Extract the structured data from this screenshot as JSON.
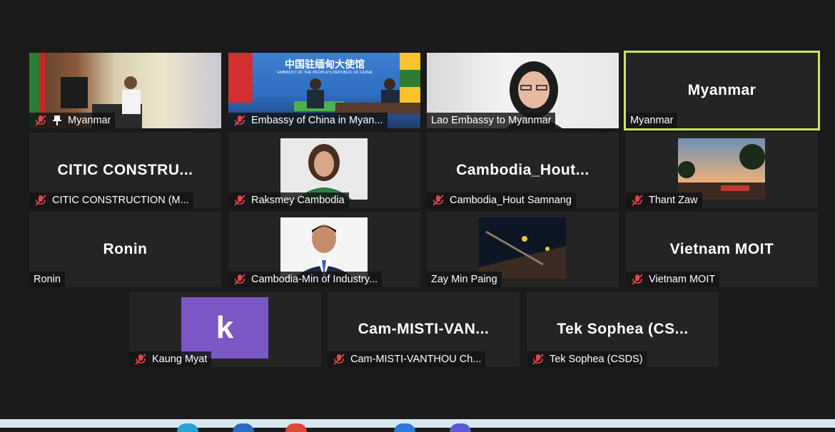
{
  "gallery": {
    "tiles": [
      {
        "label": "Myanmar",
        "muted": true,
        "pinned": true,
        "kind": "video-speaker"
      },
      {
        "label": "Embassy of China in Myan...",
        "muted": true,
        "kind": "video-embassy",
        "banner_cn": "中国驻缅甸大使馆",
        "banner_en": "EMBASSY OF THE PEOPLE'S REPUBLIC OF CHINA"
      },
      {
        "label": "Lao Embassy to Myanmar",
        "muted": false,
        "kind": "video-lao"
      },
      {
        "label": "Myanmar",
        "muted": false,
        "kind": "name",
        "display_name": "Myanmar",
        "active_speaker": true
      },
      {
        "label": "CITIC CONSTRUCTION (M...",
        "muted": true,
        "kind": "name",
        "display_name": "CITIC  CONSTRU..."
      },
      {
        "label": "Raksmey Cambodia",
        "muted": true,
        "kind": "photo"
      },
      {
        "label": "Cambodia_Hout Samnang",
        "muted": true,
        "kind": "name",
        "display_name": "Cambodia_Hout..."
      },
      {
        "label": "Thant Zaw",
        "muted": true,
        "kind": "photo"
      },
      {
        "label": "Ronin",
        "muted": false,
        "kind": "name",
        "display_name": "Ronin"
      },
      {
        "label": "Cambodia-Min of Industry...",
        "muted": true,
        "kind": "photo"
      },
      {
        "label": "Zay Min Paing",
        "muted": false,
        "kind": "photo"
      },
      {
        "label": "Vietnam MOIT",
        "muted": true,
        "kind": "name",
        "display_name": "Vietnam MOIT"
      },
      {
        "label": "Kaung Myat",
        "muted": true,
        "kind": "avatar",
        "avatar_letter": "k"
      },
      {
        "label": "Cam-MISTI-VANTHOU Ch...",
        "muted": true,
        "kind": "name",
        "display_name": "Cam-MISTI-VAN..."
      },
      {
        "label": "Tek Sophea (CSDS)",
        "muted": true,
        "kind": "name",
        "display_name": "Tek Sophea (CS..."
      }
    ]
  },
  "colors": {
    "background": "#1a1a1a",
    "tile": "#242424",
    "active_border": "#c8e65a",
    "muted_icon": "#e0464e",
    "avatar": "#7a57c4"
  },
  "icons": {
    "muted": "muted-mic-icon",
    "pinned": "pin-icon"
  }
}
